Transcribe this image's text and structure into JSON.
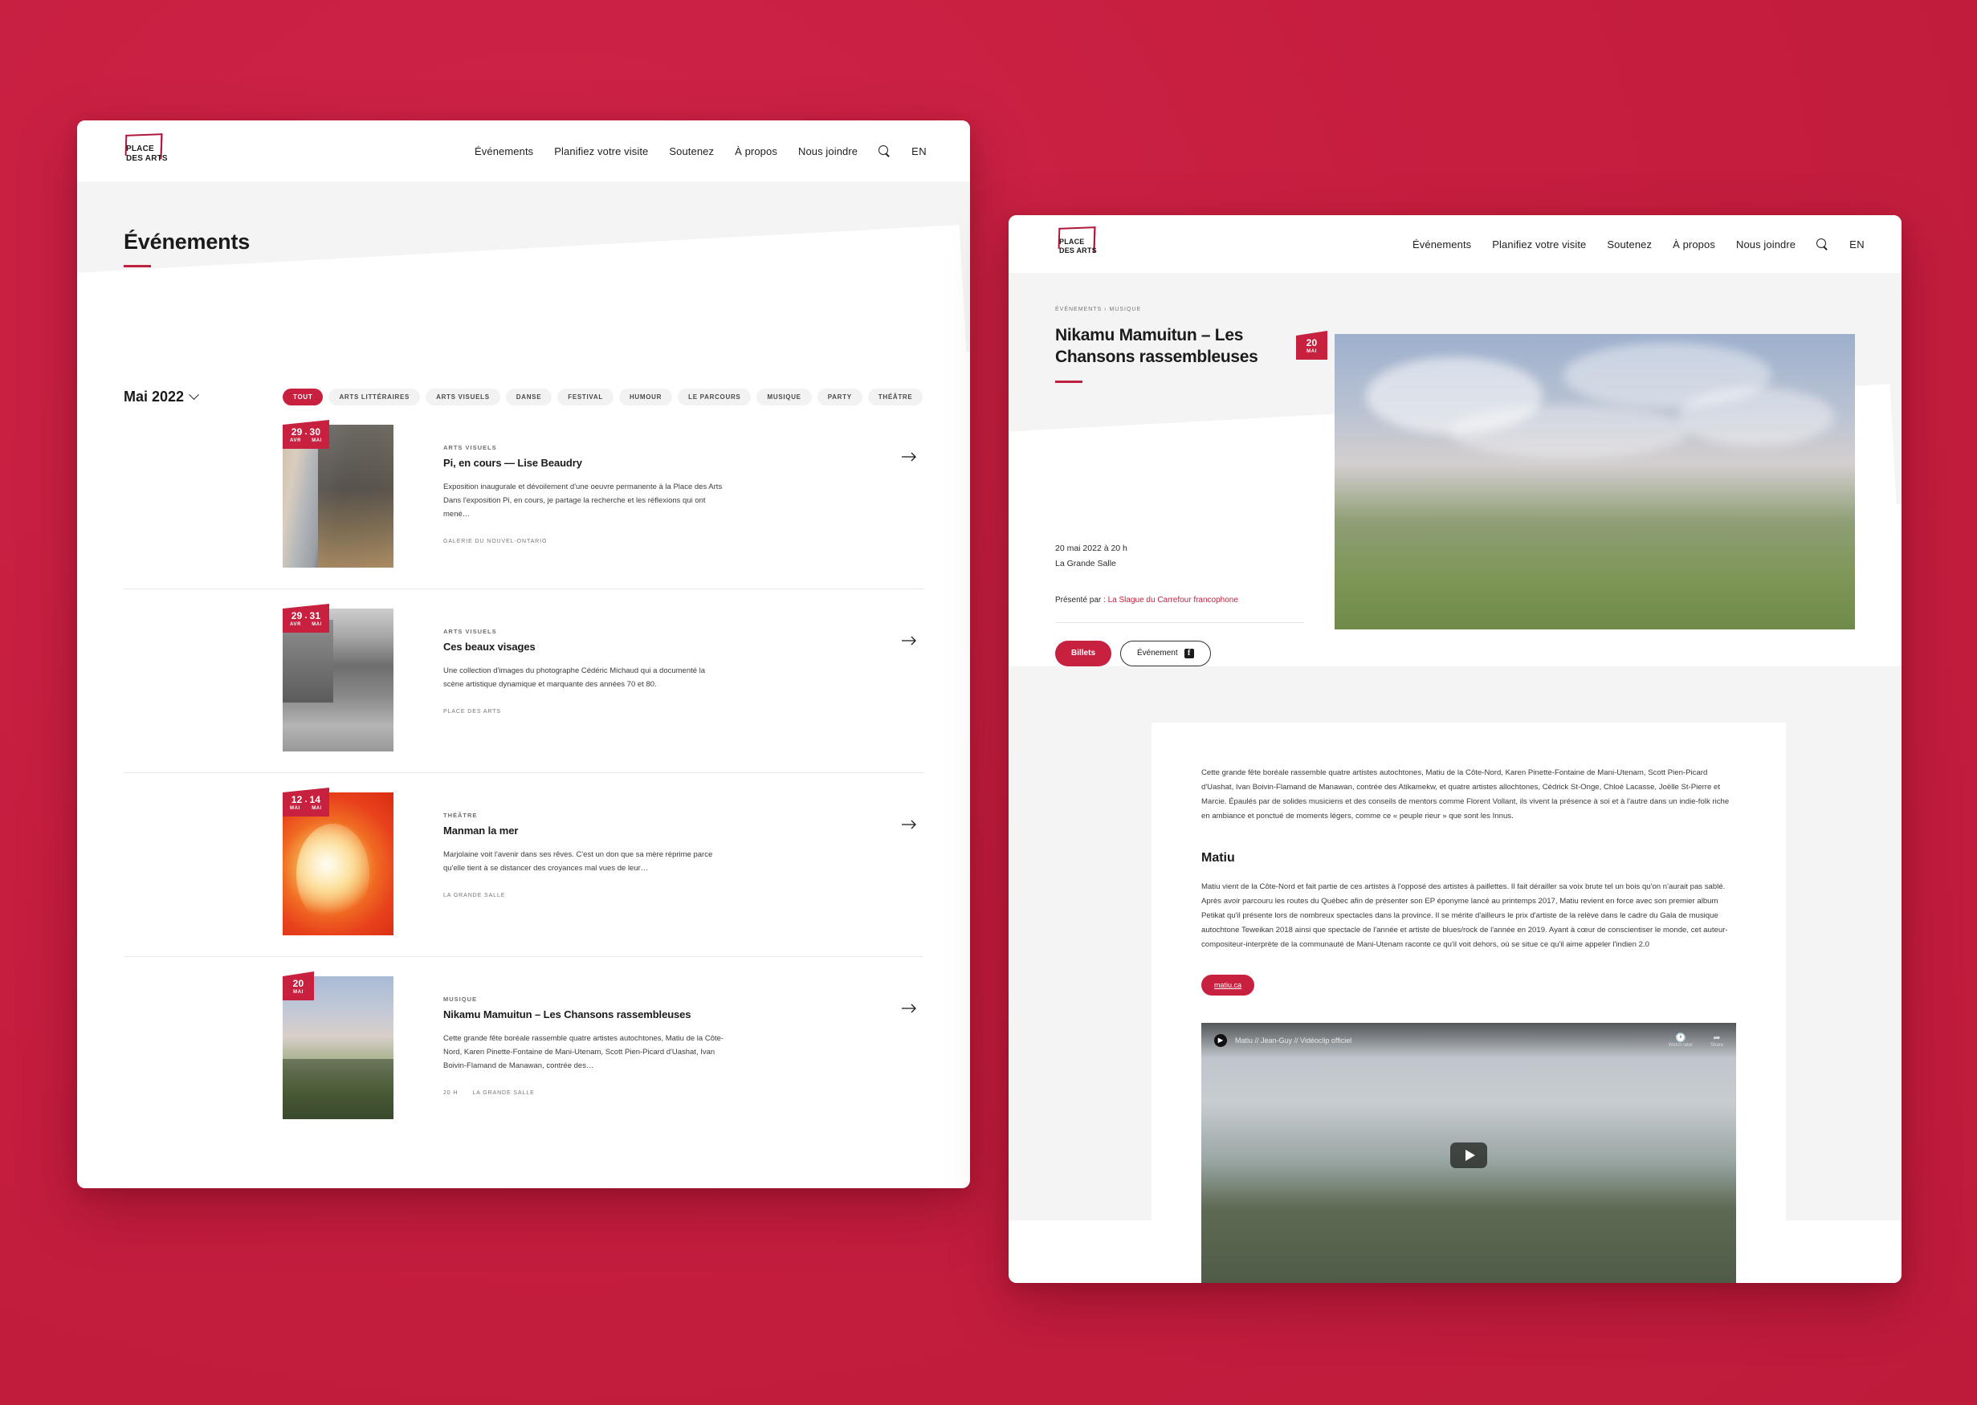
{
  "brand": {
    "logo_line1": "PLACE",
    "logo_line2": "DES ARTS",
    "accent": "#C8203F",
    "background": "#C61E3F"
  },
  "nav": {
    "items": [
      {
        "label": "Événements"
      },
      {
        "label": "Planifiez votre visite"
      },
      {
        "label": "Soutenez"
      },
      {
        "label": "À propos"
      },
      {
        "label": "Nous joindre"
      }
    ],
    "search_icon": "search-icon",
    "language": "EN"
  },
  "events_page": {
    "title": "Événements",
    "month_filter": "Mai 2022",
    "chips": [
      {
        "label": "TOUT",
        "active": true
      },
      {
        "label": "ARTS LITTÉRAIRES",
        "active": false
      },
      {
        "label": "ARTS VISUELS",
        "active": false
      },
      {
        "label": "DANSE",
        "active": false
      },
      {
        "label": "FESTIVAL",
        "active": false
      },
      {
        "label": "HUMOUR",
        "active": false
      },
      {
        "label": "LE PARCOURS",
        "active": false
      },
      {
        "label": "MUSIQUE",
        "active": false
      },
      {
        "label": "PARTY",
        "active": false
      },
      {
        "label": "THÉÂTRE",
        "active": false
      }
    ],
    "cards": [
      {
        "date_start_day": "29",
        "date_start_month": "AVR",
        "date_end_day": "30",
        "date_end_month": "MAI",
        "kicker": "ARTS VISUELS",
        "title": "Pi, en cours — Lise Beaudry",
        "desc": "Exposition inaugurale et dévoilement d'une oeuvre permanente à la Place des Arts Dans l'exposition Pi, en cours, je partage la recherche et les réflexions qui ont mené…",
        "meta_time": "",
        "meta_venue": "GALERIE DU NOUVEL-ONTARIO"
      },
      {
        "date_start_day": "29",
        "date_start_month": "AVR",
        "date_end_day": "31",
        "date_end_month": "MAI",
        "kicker": "ARTS VISUELS",
        "title": "Ces beaux visages",
        "desc": "Une collection d'images du photographe Cédéric Michaud qui a documenté la scène artistique dynamique et marquante des années 70 et 80.",
        "meta_time": "",
        "meta_venue": "PLACE DES ARTS"
      },
      {
        "date_start_day": "12",
        "date_start_month": "MAI",
        "date_end_day": "14",
        "date_end_month": "MAI",
        "kicker": "THÉÂTRE",
        "title": "Manman la mer",
        "desc": "Marjolaine voit l'avenir dans ses rêves. C'est un don que sa mère réprime parce qu'elle tient à se distancer des croyances mal vues de leur…",
        "meta_time": "",
        "meta_venue": "LA GRANDE SALLE"
      },
      {
        "date_start_day": "20",
        "date_start_month": "MAI",
        "date_end_day": "",
        "date_end_month": "",
        "kicker": "MUSIQUE",
        "title": "Nikamu Mamuitun – Les Chansons rassembleuses",
        "desc": "Cette grande fête boréale rassemble quatre artistes autochtones, Matiu de la Côte-Nord, Karen Pinette-Fontaine de Mani-Utenam, Scott Pien-Picard d'Uashat, Ivan Boivin-Flamand de Manawan, contrée des…",
        "meta_time": "20 H",
        "meta_venue": "LA GRANDE SALLE"
      }
    ]
  },
  "detail_page": {
    "breadcrumb": "ÉVÉNEMENTS  ›  MUSIQUE",
    "title": "Nikamu Mamuitun – Les Chansons rassembleuses",
    "date_line": "20 mai 2022 à 20 h",
    "venue_line": "La Grande Salle",
    "presented_label": "Présenté par : ",
    "presented_by": "La Slague du Carrefour francophone",
    "tickets_button": "Billets",
    "facebook_button": "Événement",
    "facebook_glyph": "f",
    "hero_badge_day": "20",
    "hero_badge_month": "MAI",
    "intro_paragraph": "Cette grande fête boréale rassemble quatre artistes autochtones, Matiu de la Côte-Nord, Karen Pinette-Fontaine de Mani-Utenam, Scott Pien-Picard d'Uashat, Ivan Boivin-Flamand de Manawan, contrée des Atikamekw, et quatre artistes allochtones, Cédrick St-Onge, Chloé Lacasse, Joëlle St-Pierre et Marcie. Épaulés par de solides musiciens et des conseils de mentors comme Florent Vollant, ils vivent la présence à soi et à l'autre dans un indie-folk riche en ambiance et ponctué de moments légers, comme ce « peuple rieur » que sont les Innus.",
    "section_heading": "Matiu",
    "section_paragraph": "Matiu vient de la Côte-Nord et fait partie de ces artistes à l'opposé des artistes à paillettes. Il fait dérailler sa voix brute tel un bois qu'on n'aurait pas sablé. Après avoir parcouru les routes du Québec afin de présenter son EP éponyme lancé au printemps 2017, Matiu revient en force avec son premier album Petikat qu'il présente lors de nombreux spectacles dans la province. Il se mérite d'ailleurs le prix d'artiste de la relève dans le cadre du Gala de musique autochtone Teweikan 2018 ainsi que spectacle de l'année et artiste de blues/rock de l'année en 2019. Ayant à cœur de conscientiser le monde, cet auteur-compositeur-interprète de la communauté de Mani-Utenam raconte ce qu'il voit dehors, où se situe ce qu'il aime appeler l'indien 2.0",
    "external_link": "matiu.ca",
    "video": {
      "title": "Matiu // Jean-Guy // Vidéoclip officiel",
      "watch_later": "Watch later",
      "share": "Share",
      "watch_later_icon": "clock-icon",
      "share_icon": "share-arrow-icon",
      "play_icon": "play-icon"
    }
  }
}
